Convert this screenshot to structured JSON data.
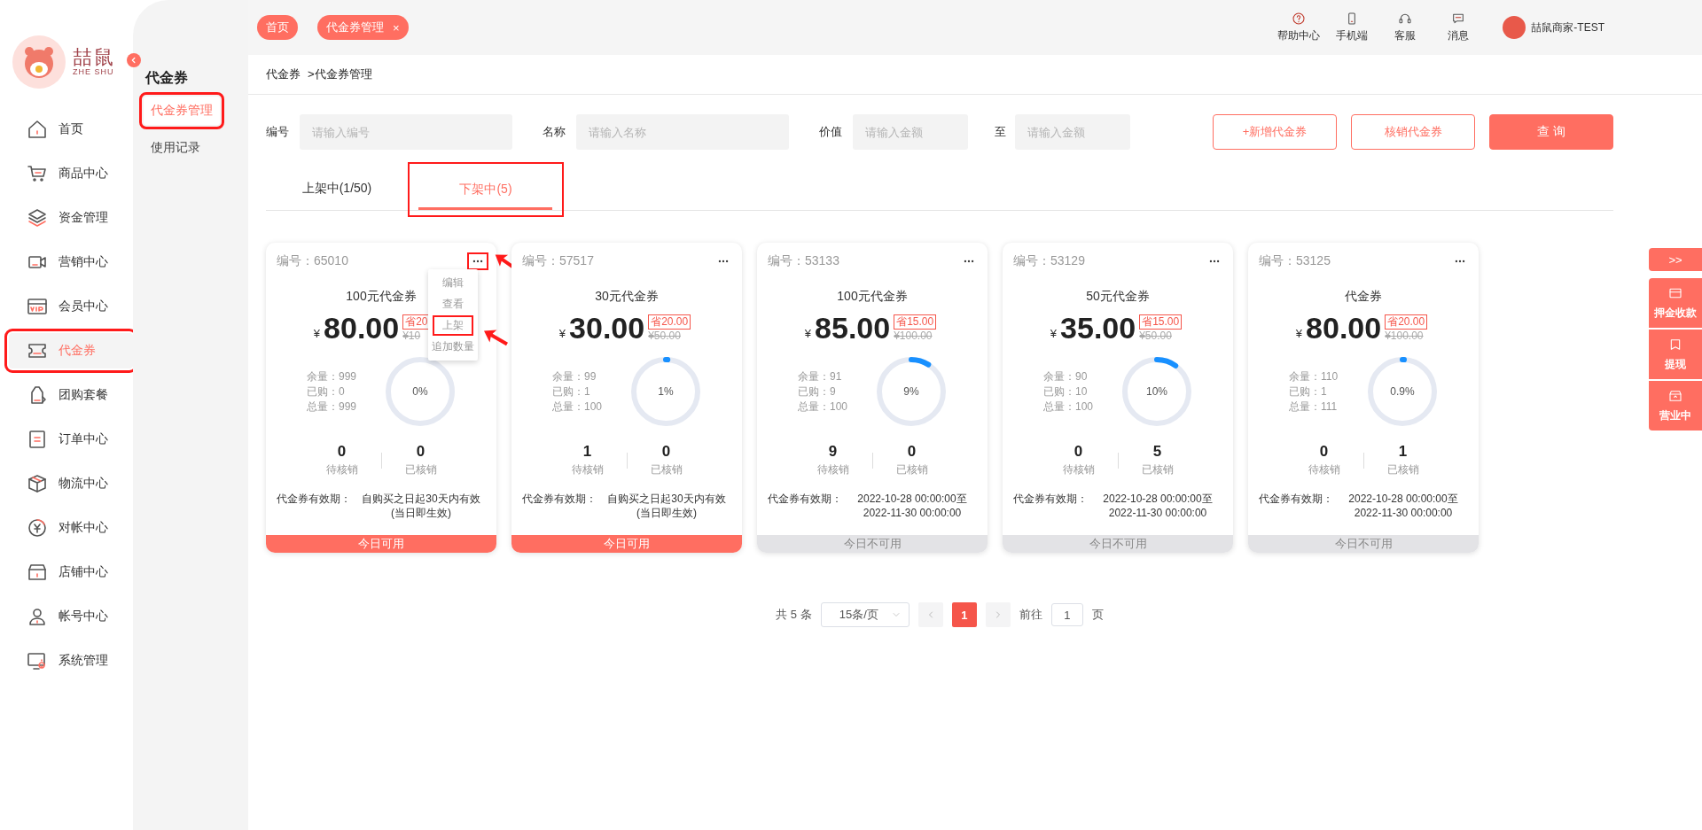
{
  "sidebar": {
    "logo": {
      "title": "喆鼠",
      "subtitle": "ZHE SHU"
    },
    "items": [
      {
        "label": "首页",
        "selected": false,
        "annotated": false
      },
      {
        "label": "商品中心",
        "selected": false,
        "annotated": false
      },
      {
        "label": "资金管理",
        "selected": false,
        "annotated": false
      },
      {
        "label": "营销中心",
        "selected": false,
        "annotated": false
      },
      {
        "label": "会员中心",
        "selected": false,
        "annotated": false
      },
      {
        "label": "代金券",
        "selected": true,
        "annotated": true
      },
      {
        "label": "团购套餐",
        "selected": false,
        "annotated": false
      },
      {
        "label": "订单中心",
        "selected": false,
        "annotated": false
      },
      {
        "label": "物流中心",
        "selected": false,
        "annotated": false
      },
      {
        "label": "对帐中心",
        "selected": false,
        "annotated": false
      },
      {
        "label": "店铺中心",
        "selected": false,
        "annotated": false
      },
      {
        "label": "帐号中心",
        "selected": false,
        "annotated": false
      },
      {
        "label": "系统管理",
        "selected": false,
        "annotated": false
      }
    ]
  },
  "submenu": {
    "title": "代金券",
    "items": [
      {
        "label": "代金券管理",
        "selected": true,
        "annotated": true
      },
      {
        "label": "使用记录",
        "selected": false,
        "annotated": false
      }
    ]
  },
  "top_tabs": [
    {
      "label": "首页"
    },
    {
      "label": "代金券管理",
      "close": "×"
    }
  ],
  "header_actions": [
    {
      "label": "帮助中心"
    },
    {
      "label": "手机端"
    },
    {
      "label": "客服"
    },
    {
      "label": "消息"
    }
  ],
  "user": {
    "name": "喆鼠商家-TEST"
  },
  "breadcrumb": [
    "代金券",
    ">代金券管理"
  ],
  "filters": {
    "fields": [
      {
        "label": "编号",
        "placeholder": "请输入编号"
      },
      {
        "label": "名称",
        "placeholder": "请输入名称"
      },
      {
        "label": "价值",
        "placeholder": "请输入金额"
      }
    ],
    "range_to": {
      "label": "至",
      "placeholder": "请输入金额"
    }
  },
  "buttons": [
    {
      "label": "+新增代金券",
      "kind": "outline"
    },
    {
      "label": "核销代金券",
      "kind": "outline"
    },
    {
      "label": "查 询",
      "kind": "primary"
    }
  ],
  "status_tabs": [
    {
      "label": "上架中(1/50)",
      "selected": false,
      "annotated": false
    },
    {
      "label": "下架中(5)",
      "selected": true,
      "annotated": true
    }
  ],
  "coupons": [
    {
      "id": "编号：65010",
      "title": "100元代金券",
      "currency": "¥",
      "price": "80.00",
      "saving": "省20",
      "original": "¥10",
      "remain": "余量：999",
      "bought": "已购：0",
      "total": "总量：999",
      "level": 0,
      "percent": "0%",
      "pending": "0",
      "pending_label": "待核销",
      "redeemed": "0",
      "redeemed_label": "已核销",
      "validity_label": "代金券有效期：",
      "validity": [
        "自购买之日起30天内有效",
        "(当日即生效)"
      ],
      "available": true,
      "status": "今日可用",
      "more_annotated": true,
      "menu_open": true,
      "menu": [
        {
          "label": "编辑",
          "annotated": false
        },
        {
          "label": "查看",
          "annotated": false
        },
        {
          "label": "上架",
          "annotated": true
        },
        {
          "label": "追加数量",
          "annotated": false
        }
      ]
    },
    {
      "id": "编号：57517",
      "title": "30元代金券",
      "currency": "¥",
      "price": "30.00",
      "saving": "省20.00",
      "original": "¥50.00",
      "remain": "余量：99",
      "bought": "已购：1",
      "total": "总量：100",
      "level": 0.01,
      "percent": "1%",
      "pending": "1",
      "pending_label": "待核销",
      "redeemed": "0",
      "redeemed_label": "已核销",
      "validity_label": "代金券有效期：",
      "validity": [
        "自购买之日起30天内有效",
        "(当日即生效)"
      ],
      "available": true,
      "status": "今日可用"
    },
    {
      "id": "编号：53133",
      "title": "100元代金券",
      "currency": "¥",
      "price": "85.00",
      "saving": "省15.00",
      "original": "¥100.00",
      "remain": "余量：91",
      "bought": "已购：9",
      "total": "总量：100",
      "level": 0.09,
      "percent": "9%",
      "pending": "9",
      "pending_label": "待核销",
      "redeemed": "0",
      "redeemed_label": "已核销",
      "validity_label": "代金券有效期：",
      "validity": [
        "2022-10-28 00:00:00至",
        "2022-11-30 00:00:00"
      ],
      "available": false,
      "status": "今日不可用"
    },
    {
      "id": "编号：53129",
      "title": "50元代金券",
      "currency": "¥",
      "price": "35.00",
      "saving": "省15.00",
      "original": "¥50.00",
      "remain": "余量：90",
      "bought": "已购：10",
      "total": "总量：100",
      "level": 0.1,
      "percent": "10%",
      "pending": "0",
      "pending_label": "待核销",
      "redeemed": "5",
      "redeemed_label": "已核销",
      "validity_label": "代金券有效期：",
      "validity": [
        "2022-10-28 00:00:00至",
        "2022-11-30 00:00:00"
      ],
      "available": false,
      "status": "今日不可用"
    },
    {
      "id": "编号：53125",
      "title": "代金券",
      "currency": "¥",
      "price": "80.00",
      "saving": "省20.00",
      "original": "¥100.00",
      "remain": "余量：110",
      "bought": "已购：1",
      "total": "总量：111",
      "level": 0.009,
      "percent": "0.9%",
      "pending": "0",
      "pending_label": "待核销",
      "redeemed": "1",
      "redeemed_label": "已核销",
      "validity_label": "代金券有效期：",
      "validity": [
        "2022-10-28 00:00:00至",
        "2022-11-30 00:00:00"
      ],
      "available": false,
      "status": "今日不可用"
    }
  ],
  "pagination": {
    "total": "共 5 条",
    "page_size": "15条/页",
    "pages": [
      {
        "label": "1",
        "selected": true
      }
    ],
    "goto_label": "前往",
    "goto_value": "1",
    "goto_suffix": "页"
  },
  "quick_actions": {
    "toggle": ">>",
    "items": [
      {
        "label": "押金收款"
      },
      {
        "label": "提现"
      },
      {
        "label": "营业中"
      }
    ]
  }
}
